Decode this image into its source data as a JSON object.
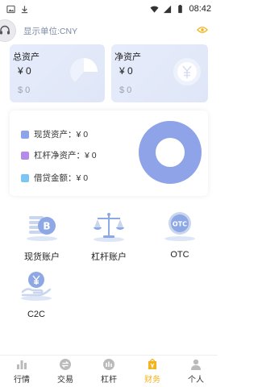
{
  "statusbar": {
    "time": "08:42"
  },
  "header": {
    "display_unit": "显示单位:CNY"
  },
  "cards": {
    "total": {
      "title": "总资产",
      "cny": "¥ 0",
      "usd": "$ 0"
    },
    "net": {
      "title": "净资产",
      "cny": "¥ 0",
      "usd": "$ 0"
    }
  },
  "breakdown": {
    "items": [
      {
        "label": "现货资产：¥ 0",
        "color": "#8fa3e8"
      },
      {
        "label": "杠杆净资产：¥ 0",
        "color": "#b58be6"
      },
      {
        "label": "借贷金额：¥ 0",
        "color": "#7ec6f2"
      }
    ],
    "donut_color": "#8fa3e8"
  },
  "accounts": [
    {
      "label": "现货账户"
    },
    {
      "label": "杠杆账户"
    },
    {
      "label": "OTC"
    },
    {
      "label": "C2C"
    }
  ],
  "tabbar": {
    "items": [
      {
        "label": "行情"
      },
      {
        "label": "交易"
      },
      {
        "label": "杠杆"
      },
      {
        "label": "财务"
      },
      {
        "label": "个人"
      }
    ],
    "active_color": "#f3b31b"
  }
}
